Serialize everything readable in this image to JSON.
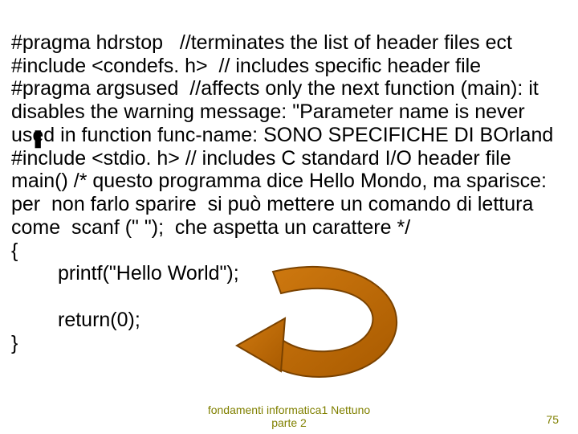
{
  "slide": {
    "line1": "#pragma hdrstop   //terminates the list of header files ect",
    "line2": "#include <condefs. h>  // includes specific header file",
    "line3": "#pragma argsused  //affects only the next function (main): it disables the warning message: \"Parameter name is never used in function func-name: SONO SPECIFICHE DI BOrland",
    "line4": "#include <stdio. h> // includes C standard I/O header file",
    "line5": "main() /* questo programma dice Hello Mondo, ma sparisce: per  non farlo sparire  si può mettere un comando di lettura come  scanf (\" \");  che aspetta un carattere */",
    "line6": "{",
    "line7": "printf(\"Hello World\");",
    "line8": "",
    "line9": "return(0);",
    "line10": "}",
    "bullet": "❚"
  },
  "footer": {
    "center_line1": "fondamenti informatica1 Nettuno",
    "center_line2": "parte 2",
    "page": "75"
  },
  "arrow": {
    "name": "curved-arrow"
  }
}
